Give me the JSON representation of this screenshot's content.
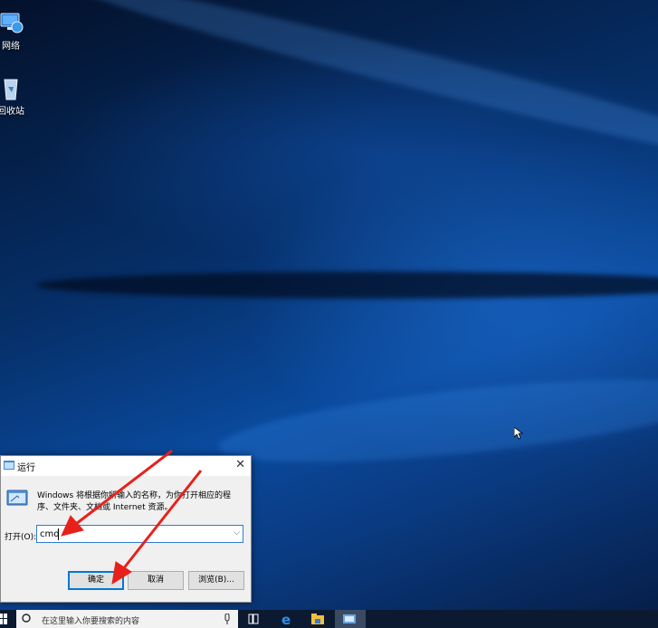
{
  "desktop": {
    "icons": [
      {
        "label": "网络",
        "icon": "network-icon"
      },
      {
        "label": "回收站",
        "icon": "recycle-bin-icon"
      }
    ]
  },
  "run_dialog": {
    "title": "运行",
    "description": "Windows 将根据你所输入的名称，为你打开相应的程序、文件夹、文档或 Internet 资源。",
    "open_label": "打开(O):",
    "input_value": "cmd",
    "ok_label": "确定",
    "cancel_label": "取消",
    "browse_label": "浏览(B)..."
  },
  "taskbar": {
    "search_placeholder": "在这里输入你要搜索的内容",
    "apps": [
      "task-view-icon",
      "edge-icon",
      "file-explorer-icon",
      "run-icon"
    ]
  },
  "colors": {
    "accent": "#0078d7",
    "arrow": "#e8201a",
    "taskbar": "#0b1a30"
  }
}
